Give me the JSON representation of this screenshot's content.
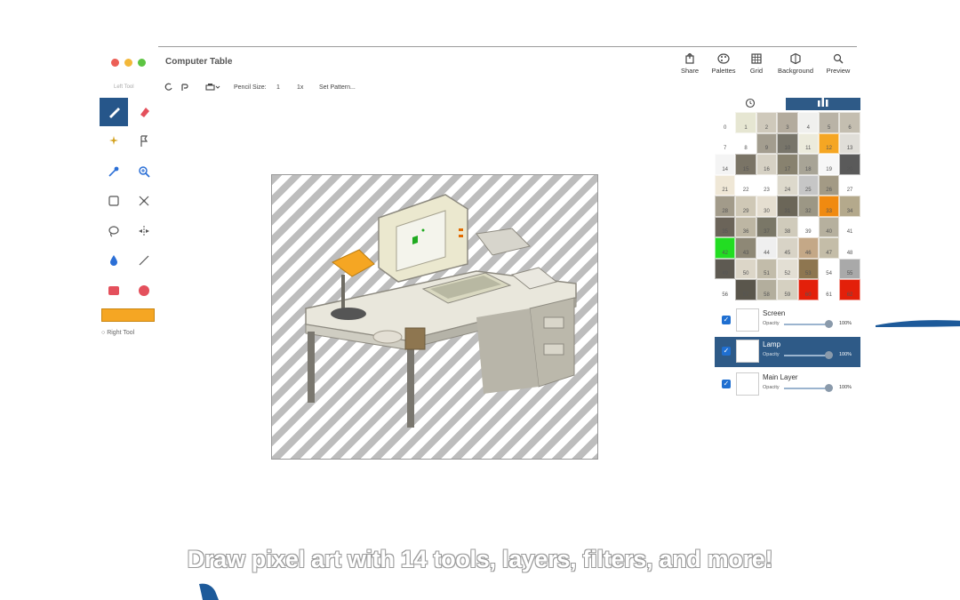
{
  "window": {
    "title": "Computer Table",
    "traffic_lights": {
      "close": "#ec5f57",
      "minimize": "#f3b83a",
      "zoom": "#5dc442"
    }
  },
  "toolbar": {
    "buttons": [
      {
        "label": "Share",
        "icon": "share-icon"
      },
      {
        "label": "Palettes",
        "icon": "palette-icon"
      },
      {
        "label": "Grid",
        "icon": "grid-icon"
      },
      {
        "label": "Background",
        "icon": "background-icon"
      },
      {
        "label": "Preview",
        "icon": "magnifier-icon"
      }
    ]
  },
  "subbar": {
    "pencil_size_label": "Pencil Size:",
    "pencil_size_value": "1",
    "pattern_size": "1x",
    "set_pattern_label": "Set Pattern..."
  },
  "tools": {
    "header": "Left Tool",
    "items": [
      "pencil-icon",
      "eraser-icon",
      "magic-wand-icon",
      "fill-bucket-icon",
      "eyedropper-icon",
      "zoom-icon",
      "rect-select-icon",
      "move-icon",
      "lasso-icon",
      "symmetry-icon",
      "drop-icon",
      "line-icon",
      "rectangle-icon",
      "circle-icon"
    ],
    "selected": "pencil-icon",
    "left_color": "#f5a623",
    "right_tool_label": "Right Tool"
  },
  "palette": {
    "tab_left_icon": "clock-icon",
    "tab_right_icon": "bars-icon",
    "cells": [
      {
        "n": "0",
        "c": "#ffffff"
      },
      {
        "n": "1",
        "c": "#e6e6d2"
      },
      {
        "n": "2",
        "c": "#cfc9bb"
      },
      {
        "n": "3",
        "c": "#b3ab9d"
      },
      {
        "n": "4",
        "c": "#f0f0ee"
      },
      {
        "n": "5",
        "c": "#b9b3a6"
      },
      {
        "n": "6",
        "c": "#c4beb0"
      },
      {
        "n": "7",
        "c": "#ffffff"
      },
      {
        "n": "8",
        "c": "#ffffff"
      },
      {
        "n": "9",
        "c": "#a39d8f"
      },
      {
        "n": "10",
        "c": "#78756a"
      },
      {
        "n": "11",
        "c": "#ecebdc"
      },
      {
        "n": "12",
        "c": "#f5a623"
      },
      {
        "n": "13",
        "c": "#e0ded8"
      },
      {
        "n": "14",
        "c": "#f4f4f4"
      },
      {
        "n": "15",
        "c": "#7a7466"
      },
      {
        "n": "16",
        "c": "#d6d1c4"
      },
      {
        "n": "17",
        "c": "#88826f"
      },
      {
        "n": "18",
        "c": "#a8a496"
      },
      {
        "n": "19",
        "c": "#f7f7f7"
      },
      {
        "n": "20",
        "c": "#5a5a5a"
      },
      {
        "n": "21",
        "c": "#efe7d6"
      },
      {
        "n": "22",
        "c": "#ffffff"
      },
      {
        "n": "23",
        "c": "#ffffff"
      },
      {
        "n": "24",
        "c": "#ddd9cc"
      },
      {
        "n": "25",
        "c": "#c6c6c6"
      },
      {
        "n": "26",
        "c": "#a39a85"
      },
      {
        "n": "27",
        "c": "#ffffff"
      },
      {
        "n": "28",
        "c": "#a29b8a"
      },
      {
        "n": "29",
        "c": "#cfc8b6"
      },
      {
        "n": "30",
        "c": "#e5ded0"
      },
      {
        "n": "31",
        "c": "#6b6658"
      },
      {
        "n": "32",
        "c": "#9c9785"
      },
      {
        "n": "33",
        "c": "#f08a10"
      },
      {
        "n": "34",
        "c": "#b4a98c"
      },
      {
        "n": "35",
        "c": "#6b6459"
      },
      {
        "n": "36",
        "c": "#bdb6a3"
      },
      {
        "n": "37",
        "c": "#7a7767"
      },
      {
        "n": "38",
        "c": "#d0cbbb"
      },
      {
        "n": "39",
        "c": "#ffffff"
      },
      {
        "n": "40",
        "c": "#b6b09e"
      },
      {
        "n": "41",
        "c": "#ffffff"
      },
      {
        "n": "42",
        "c": "#22dd22"
      },
      {
        "n": "43",
        "c": "#8e8876"
      },
      {
        "n": "44",
        "c": "#efefef"
      },
      {
        "n": "45",
        "c": "#d8d3c6"
      },
      {
        "n": "46",
        "c": "#c4a887"
      },
      {
        "n": "47",
        "c": "#c4bda8"
      },
      {
        "n": "48",
        "c": "#ffffff"
      },
      {
        "n": "49",
        "c": "#5e5a52"
      },
      {
        "n": "50",
        "c": "#dcd6c8"
      },
      {
        "n": "51",
        "c": "#c2bcaa"
      },
      {
        "n": "52",
        "c": "#e3dfd4"
      },
      {
        "n": "53",
        "c": "#8e7650"
      },
      {
        "n": "54",
        "c": "#ffffff"
      },
      {
        "n": "55",
        "c": "#a9a9a9"
      },
      {
        "n": "56",
        "c": "#ffffff"
      },
      {
        "n": "57",
        "c": "#5a564c"
      },
      {
        "n": "58",
        "c": "#b3ae9d"
      },
      {
        "n": "59",
        "c": "#d5d0c1"
      },
      {
        "n": "60",
        "c": "#e3200a"
      },
      {
        "n": "61",
        "c": "#ffffff"
      },
      {
        "n": "62",
        "c": "#e3200a"
      }
    ]
  },
  "layers": [
    {
      "name": "Screen",
      "opacity_label": "Opacity",
      "opacity": "100%",
      "opacity_value": 1.0,
      "visible": true,
      "selected": false
    },
    {
      "name": "Lamp",
      "opacity_label": "Opacity",
      "opacity": "100%",
      "opacity_value": 1.0,
      "visible": true,
      "selected": true
    },
    {
      "name": "Main Layer",
      "opacity_label": "Opacity",
      "opacity": "100%",
      "opacity_value": 1.0,
      "visible": true,
      "selected": false
    }
  ],
  "caption": "Draw pixel art with 14 tools, layers, filters, and more!",
  "accent_color": "#2e5a87"
}
